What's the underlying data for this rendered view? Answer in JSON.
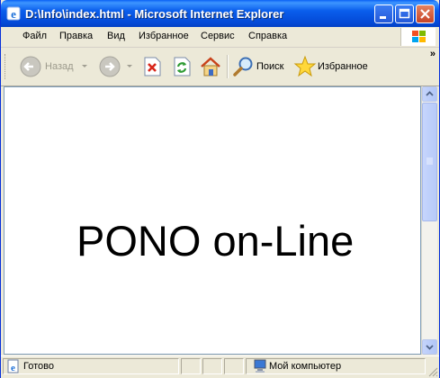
{
  "window": {
    "title": "D:\\Info\\index.html - Microsoft Internet Explorer"
  },
  "menu": {
    "items": [
      {
        "label": "Файл"
      },
      {
        "label": "Правка"
      },
      {
        "label": "Вид"
      },
      {
        "label": "Избранное"
      },
      {
        "label": "Сервис"
      },
      {
        "label": "Справка"
      }
    ]
  },
  "toolbar": {
    "back_label": "Назад",
    "search_label": "Поиск",
    "favorites_label": "Избранное",
    "overflow": "»"
  },
  "page": {
    "heading": "PONO on-Line"
  },
  "status": {
    "text": "Готово",
    "zone": "Мой компьютер"
  }
}
